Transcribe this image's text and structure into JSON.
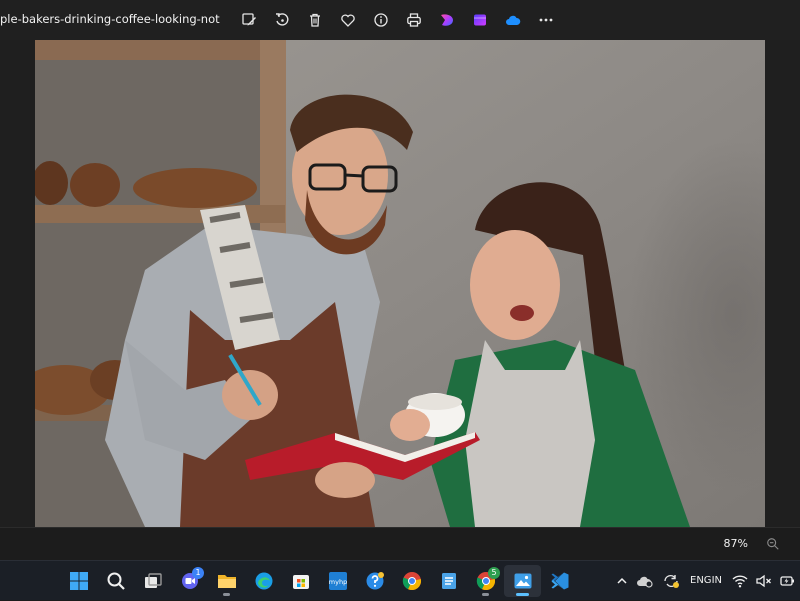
{
  "window": {
    "filename": "ple-bakers-drinking-coffee-looking-noteboo..."
  },
  "toolbar": {
    "items": [
      {
        "name": "edit-image-icon"
      },
      {
        "name": "rotate-icon"
      },
      {
        "name": "delete-icon"
      },
      {
        "name": "favorite-heart-icon"
      },
      {
        "name": "file-info-icon"
      },
      {
        "name": "print-icon"
      },
      {
        "name": "designer-app-icon"
      },
      {
        "name": "clipchamp-icon"
      },
      {
        "name": "onedrive-cloud-icon"
      },
      {
        "name": "more-options-icon"
      }
    ]
  },
  "status": {
    "zoom_label": "87%"
  },
  "taskbar": {
    "apps": [
      {
        "name": "start-button",
        "icon": "windows-logo-icon"
      },
      {
        "name": "search-button",
        "icon": "search-icon"
      },
      {
        "name": "task-view-button",
        "icon": "task-view-icon"
      },
      {
        "name": "teams-chat-button",
        "icon": "chat-icon",
        "badge": "1"
      },
      {
        "name": "file-explorer-button",
        "icon": "folder-icon"
      },
      {
        "name": "edge-button",
        "icon": "edge-icon"
      },
      {
        "name": "store-button",
        "icon": "store-icon"
      },
      {
        "name": "myhp-button",
        "icon": "myhp-icon",
        "label": "myhp"
      },
      {
        "name": "help-button",
        "icon": "help-icon"
      },
      {
        "name": "chrome-button",
        "icon": "chrome-icon"
      },
      {
        "name": "notepad-button",
        "icon": "notepad-icon"
      },
      {
        "name": "chrome-profile-button",
        "icon": "chrome-icon",
        "badge": "5"
      },
      {
        "name": "photos-button",
        "icon": "photos-icon",
        "active": true
      },
      {
        "name": "vscode-button",
        "icon": "vscode-icon"
      }
    ],
    "tray": {
      "language_line1": "ENG",
      "language_line2": "IN"
    }
  },
  "colors": {
    "accent": "#5cc0ff",
    "background": "#202020",
    "taskbar": "#1b1f26"
  }
}
